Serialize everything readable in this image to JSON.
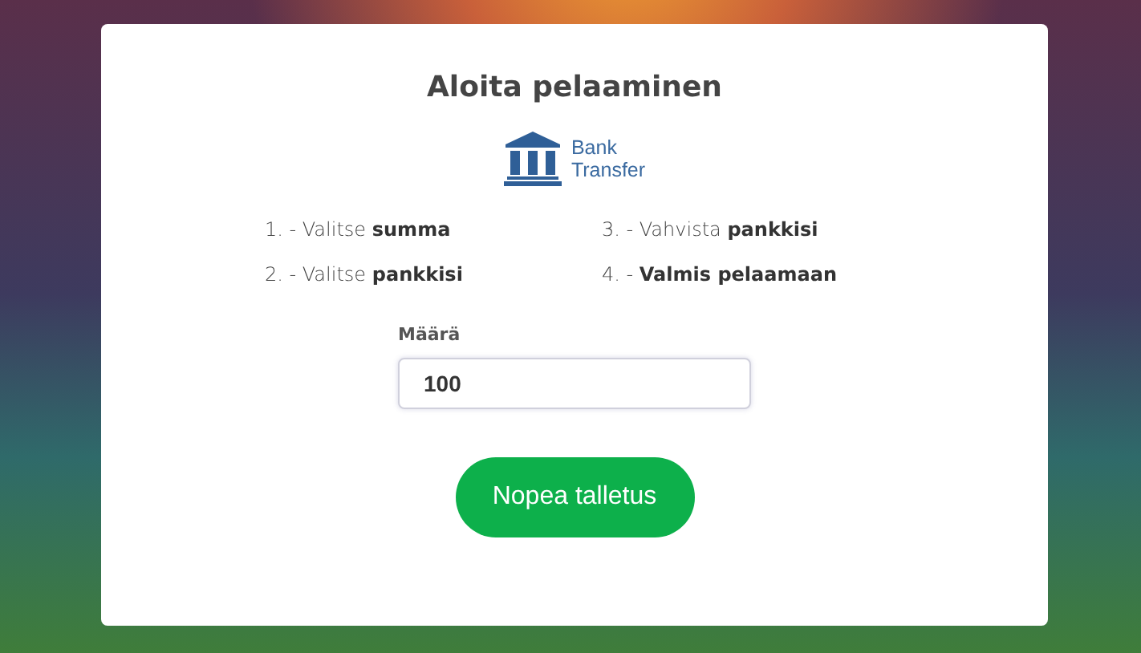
{
  "title": "Aloita pelaaminen",
  "payment_method": {
    "line_1": "Bank",
    "line_2": "Transfer"
  },
  "steps": [
    {
      "text": "1. - Valitse **summa**"
    },
    {
      "text": "3. - Vahvista **pankkisi**"
    },
    {
      "text": "2. - Valitse **pankkisi**"
    },
    {
      "text": "4. - **Valmis pelaamaan**"
    }
  ],
  "amount_field": {
    "label": "Määrä",
    "value": "100"
  },
  "submit_button": {
    "label": "Nopea talletus"
  }
}
